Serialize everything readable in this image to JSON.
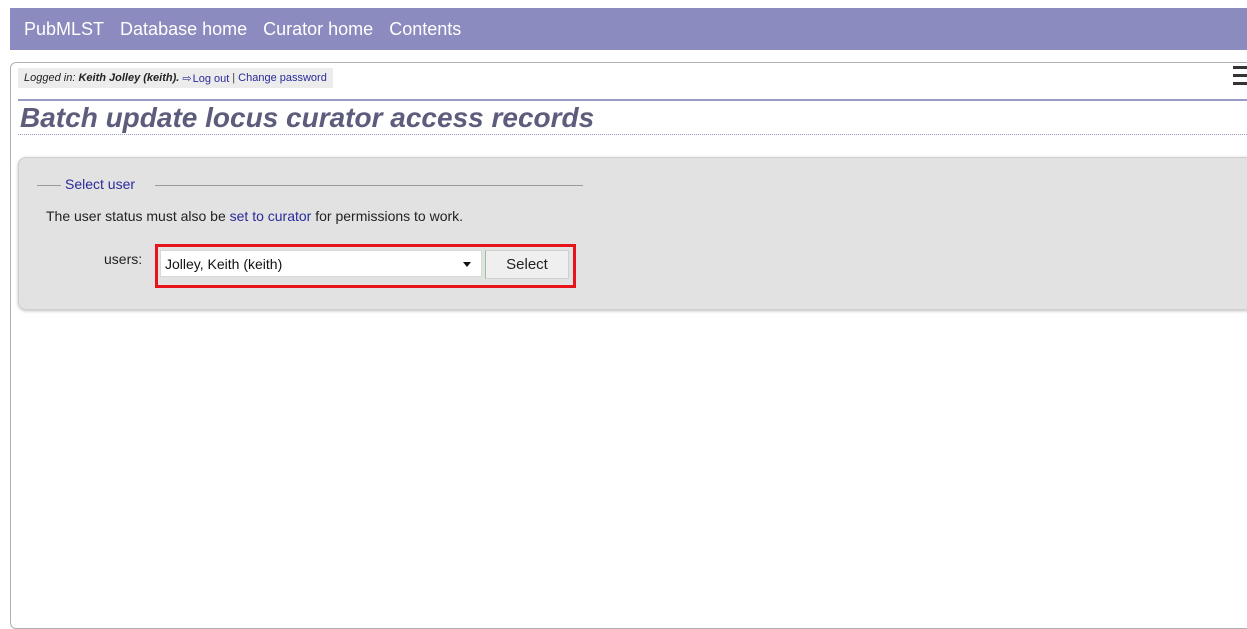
{
  "nav": {
    "items": [
      {
        "label": "PubMLST"
      },
      {
        "label": "Database home"
      },
      {
        "label": "Curator home"
      },
      {
        "label": "Contents"
      }
    ]
  },
  "login": {
    "prefix": "Logged in:",
    "user": "Keith Jolley (keith).",
    "logout_label": "Log out",
    "separator": "|",
    "change_password_label": "Change password"
  },
  "page": {
    "title": "Batch update locus curator access records"
  },
  "form": {
    "legend": "Select user",
    "info_before": "The user status must also be ",
    "info_link": "set to curator",
    "info_after": " for permissions to work.",
    "users_label": "users:",
    "users_selected": "Jolley, Keith (keith)",
    "select_button": "Select"
  },
  "colors": {
    "topbar": "#8b8bbf",
    "title": "#5c5c7c",
    "link": "#2a2a9a",
    "highlight": "#e8141c",
    "panel": "#e2e2e2"
  },
  "icons": {
    "logout": "logout-icon",
    "menu": "hamburger-menu-icon",
    "dropdown": "chevron-down-icon"
  }
}
